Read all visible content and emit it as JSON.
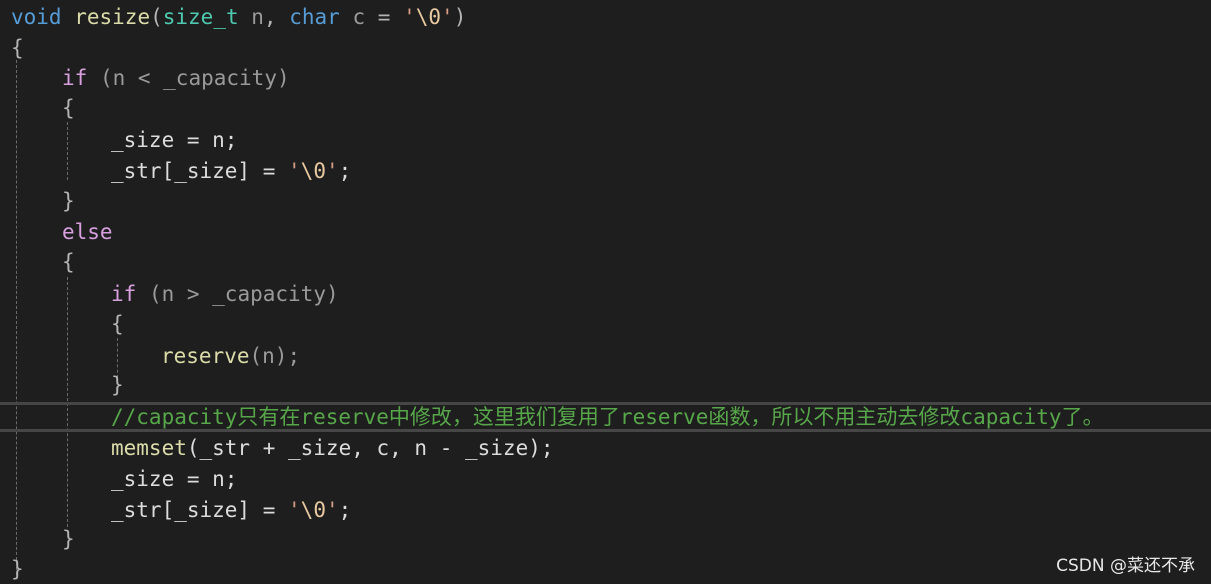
{
  "code": {
    "l1": {
      "kw_void": "void",
      "fn_name": "resize",
      "open": "(",
      "type_size": "size_t",
      "param_n": "n",
      "comma": ",",
      "kw_char": "char",
      "param_c": "c",
      "eq": "=",
      "q1": "'",
      "esc": "\\0",
      "q2": "'",
      "close": ")"
    },
    "l2": {
      "brace": "{"
    },
    "l3": {
      "kw_if": "if",
      "cond": "(n < _capacity)"
    },
    "l4": {
      "brace": "{"
    },
    "l5": {
      "stmt": "_size = n;"
    },
    "l6": {
      "pre": "_str[_size] = ",
      "q1": "'",
      "esc": "\\0",
      "q2": "'",
      "semi": ";"
    },
    "l7": {
      "brace": "}"
    },
    "l8": {
      "kw_else": "else"
    },
    "l9": {
      "brace": "{"
    },
    "l10": {
      "kw_if": "if",
      "cond": "(n > _capacity)"
    },
    "l11": {
      "brace": "{"
    },
    "l12": {
      "fn": "reserve",
      "args": "(n);"
    },
    "l13": {
      "brace": "}"
    },
    "l14": {
      "comment": "//capacity只有在reserve中修改，这里我们复用了reserve函数，所以不用主动去修改capacity了。"
    },
    "l15": {
      "fn": "memset",
      "args": "(_str + _size, c, n - _size);"
    },
    "l16": {
      "stmt": "_size = n;"
    },
    "l17": {
      "pre": "_str[_size] = ",
      "q1": "'",
      "esc": "\\0",
      "q2": "'",
      "semi": ";"
    },
    "l18": {
      "brace": "}"
    },
    "l19": {
      "brace": "}"
    }
  },
  "watermark": "CSDN @菜还不承",
  "colors": {
    "background": "#1e1e1e",
    "keyword": "#569cd6",
    "control": "#d8a0df",
    "type": "#4ec9b0",
    "function": "#dcdcaa",
    "comment": "#57a64a",
    "string": "#d69d85"
  }
}
